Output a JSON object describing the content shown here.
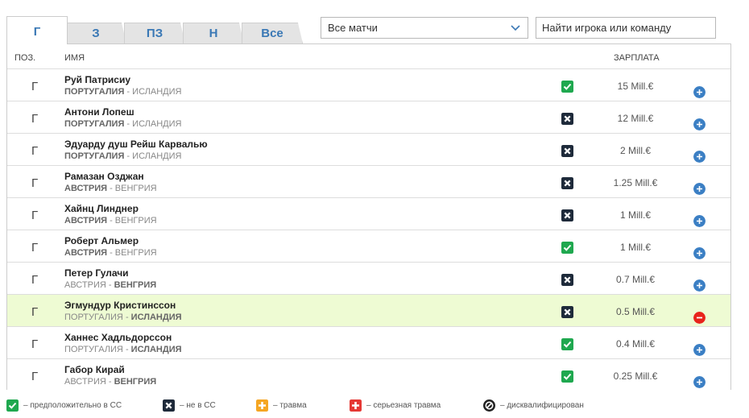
{
  "tabs": [
    {
      "label": "Г",
      "active": true
    },
    {
      "label": "З",
      "active": false
    },
    {
      "label": "ПЗ",
      "active": false
    },
    {
      "label": "Н",
      "active": false
    },
    {
      "label": "Все",
      "active": false
    }
  ],
  "filter": {
    "selected": "Все матчи"
  },
  "search": {
    "placeholder": "Найти игрока или команду"
  },
  "table": {
    "headers": {
      "position": "ПОЗ.",
      "name": "ИМЯ",
      "salary": "ЗАРПЛАТА"
    },
    "rows": [
      {
        "pos": "Г",
        "name": "Руй Патрисиу",
        "team_a": "ПОРТУГАЛИЯ",
        "sep": " - ",
        "team_b": "ИСЛАНДИЯ",
        "own_team": "a",
        "status": "check",
        "salary": "15 Mill.€",
        "action": "add",
        "highlight": false
      },
      {
        "pos": "Г",
        "name": "Антони Лопеш",
        "team_a": "ПОРТУГАЛИЯ",
        "sep": " - ",
        "team_b": "ИСЛАНДИЯ",
        "own_team": "a",
        "status": "x",
        "salary": "12 Mill.€",
        "action": "add",
        "highlight": false
      },
      {
        "pos": "Г",
        "name": "Эдуарду душ Рейш Карвалью",
        "team_a": "ПОРТУГАЛИЯ",
        "sep": " - ",
        "team_b": "ИСЛАНДИЯ",
        "own_team": "a",
        "status": "x",
        "salary": "2 Mill.€",
        "action": "add",
        "highlight": false
      },
      {
        "pos": "Г",
        "name": "Рамазан Озджан",
        "team_a": "АВСТРИЯ",
        "sep": " - ",
        "team_b": "ВЕНГРИЯ",
        "own_team": "a",
        "status": "x",
        "salary": "1.25 Mill.€",
        "action": "add",
        "highlight": false
      },
      {
        "pos": "Г",
        "name": "Хайнц Линднер",
        "team_a": "АВСТРИЯ",
        "sep": " - ",
        "team_b": "ВЕНГРИЯ",
        "own_team": "a",
        "status": "x",
        "salary": "1 Mill.€",
        "action": "add",
        "highlight": false
      },
      {
        "pos": "Г",
        "name": "Роберт Альмер",
        "team_a": "АВСТРИЯ",
        "sep": " - ",
        "team_b": "ВЕНГРИЯ",
        "own_team": "a",
        "status": "check",
        "salary": "1 Mill.€",
        "action": "add",
        "highlight": false
      },
      {
        "pos": "Г",
        "name": "Петер Гулачи",
        "team_a": "АВСТРИЯ",
        "sep": " - ",
        "team_b": "ВЕНГРИЯ",
        "own_team": "b",
        "status": "x",
        "salary": "0.7 Mill.€",
        "action": "add",
        "highlight": false
      },
      {
        "pos": "Г",
        "name": "Эгмундур Кристинссон",
        "team_a": "ПОРТУГАЛИЯ",
        "sep": " - ",
        "team_b": "ИСЛАНДИЯ",
        "own_team": "b",
        "status": "x",
        "salary": "0.5 Mill.€",
        "action": "remove",
        "highlight": true
      },
      {
        "pos": "Г",
        "name": "Ханнес Хадльдорссон",
        "team_a": "ПОРТУГАЛИЯ",
        "sep": " - ",
        "team_b": "ИСЛАНДИЯ",
        "own_team": "b",
        "status": "check",
        "salary": "0.4 Mill.€",
        "action": "add",
        "highlight": false
      },
      {
        "pos": "Г",
        "name": "Габор Кирай",
        "team_a": "АВСТРИЯ",
        "sep": " - ",
        "team_b": "ВЕНГРИЯ",
        "own_team": "b",
        "status": "check",
        "salary": "0.25 Mill.€",
        "action": "add",
        "highlight": false
      }
    ]
  },
  "legend": [
    {
      "icon": "check",
      "text": "– предположительно в СС"
    },
    {
      "icon": "x",
      "text": "– не в СС"
    },
    {
      "icon": "injury",
      "text": "– травма"
    },
    {
      "icon": "serious-injury",
      "text": "– серьезная травма"
    },
    {
      "icon": "suspended",
      "text": "– дисквалифицирован"
    }
  ],
  "colors": {
    "check": "#1fa84f",
    "x": "#1e2a3a",
    "injury": "#f5a623",
    "serious": "#e53935",
    "add": "#3b7fc4",
    "remove": "#e8231c",
    "highlight": "#eefbd3",
    "tab_text": "#3a78b5"
  }
}
